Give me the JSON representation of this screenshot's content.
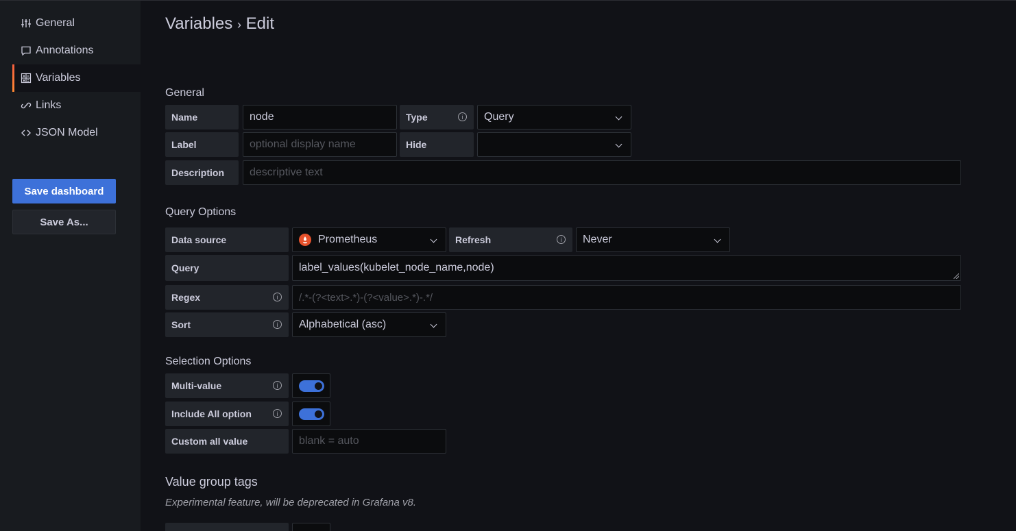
{
  "sidebar": {
    "items": [
      {
        "label": "General",
        "icon": "sliders-icon"
      },
      {
        "label": "Annotations",
        "icon": "comment-icon"
      },
      {
        "label": "Variables",
        "icon": "calculator-icon",
        "active": true
      },
      {
        "label": "Links",
        "icon": "link-icon"
      },
      {
        "label": "JSON Model",
        "icon": "code-icon"
      }
    ],
    "save_dashboard": "Save dashboard",
    "save_as": "Save As..."
  },
  "header": {
    "title": "Variables",
    "separator": "›",
    "subtitle": "Edit"
  },
  "general": {
    "title": "General",
    "name_label": "Name",
    "name_value": "node",
    "type_label": "Type",
    "type_value": "Query",
    "label_label": "Label",
    "label_placeholder": "optional display name",
    "hide_label": "Hide",
    "hide_value": "",
    "description_label": "Description",
    "description_placeholder": "descriptive text"
  },
  "query_options": {
    "title": "Query Options",
    "datasource_label": "Data source",
    "datasource_value": "Prometheus",
    "refresh_label": "Refresh",
    "refresh_value": "Never",
    "query_label": "Query",
    "query_value": "label_values(kubelet_node_name,node)",
    "regex_label": "Regex",
    "regex_placeholder": "/.*-(?<text>.*)-(?<value>.*)-.*/",
    "sort_label": "Sort",
    "sort_value": "Alphabetical (asc)"
  },
  "selection_options": {
    "title": "Selection Options",
    "multi_value_label": "Multi-value",
    "multi_value_on": true,
    "include_all_label": "Include All option",
    "include_all_on": true,
    "custom_all_label": "Custom all value",
    "custom_all_placeholder": "blank = auto"
  },
  "value_group_tags": {
    "title": "Value group tags",
    "note": "Experimental feature, will be deprecated in Grafana v8."
  },
  "colors": {
    "accent": "#3d71d9",
    "active_bar": "#f55f3e",
    "background": "#111217",
    "sidebar": "#181b1f"
  }
}
